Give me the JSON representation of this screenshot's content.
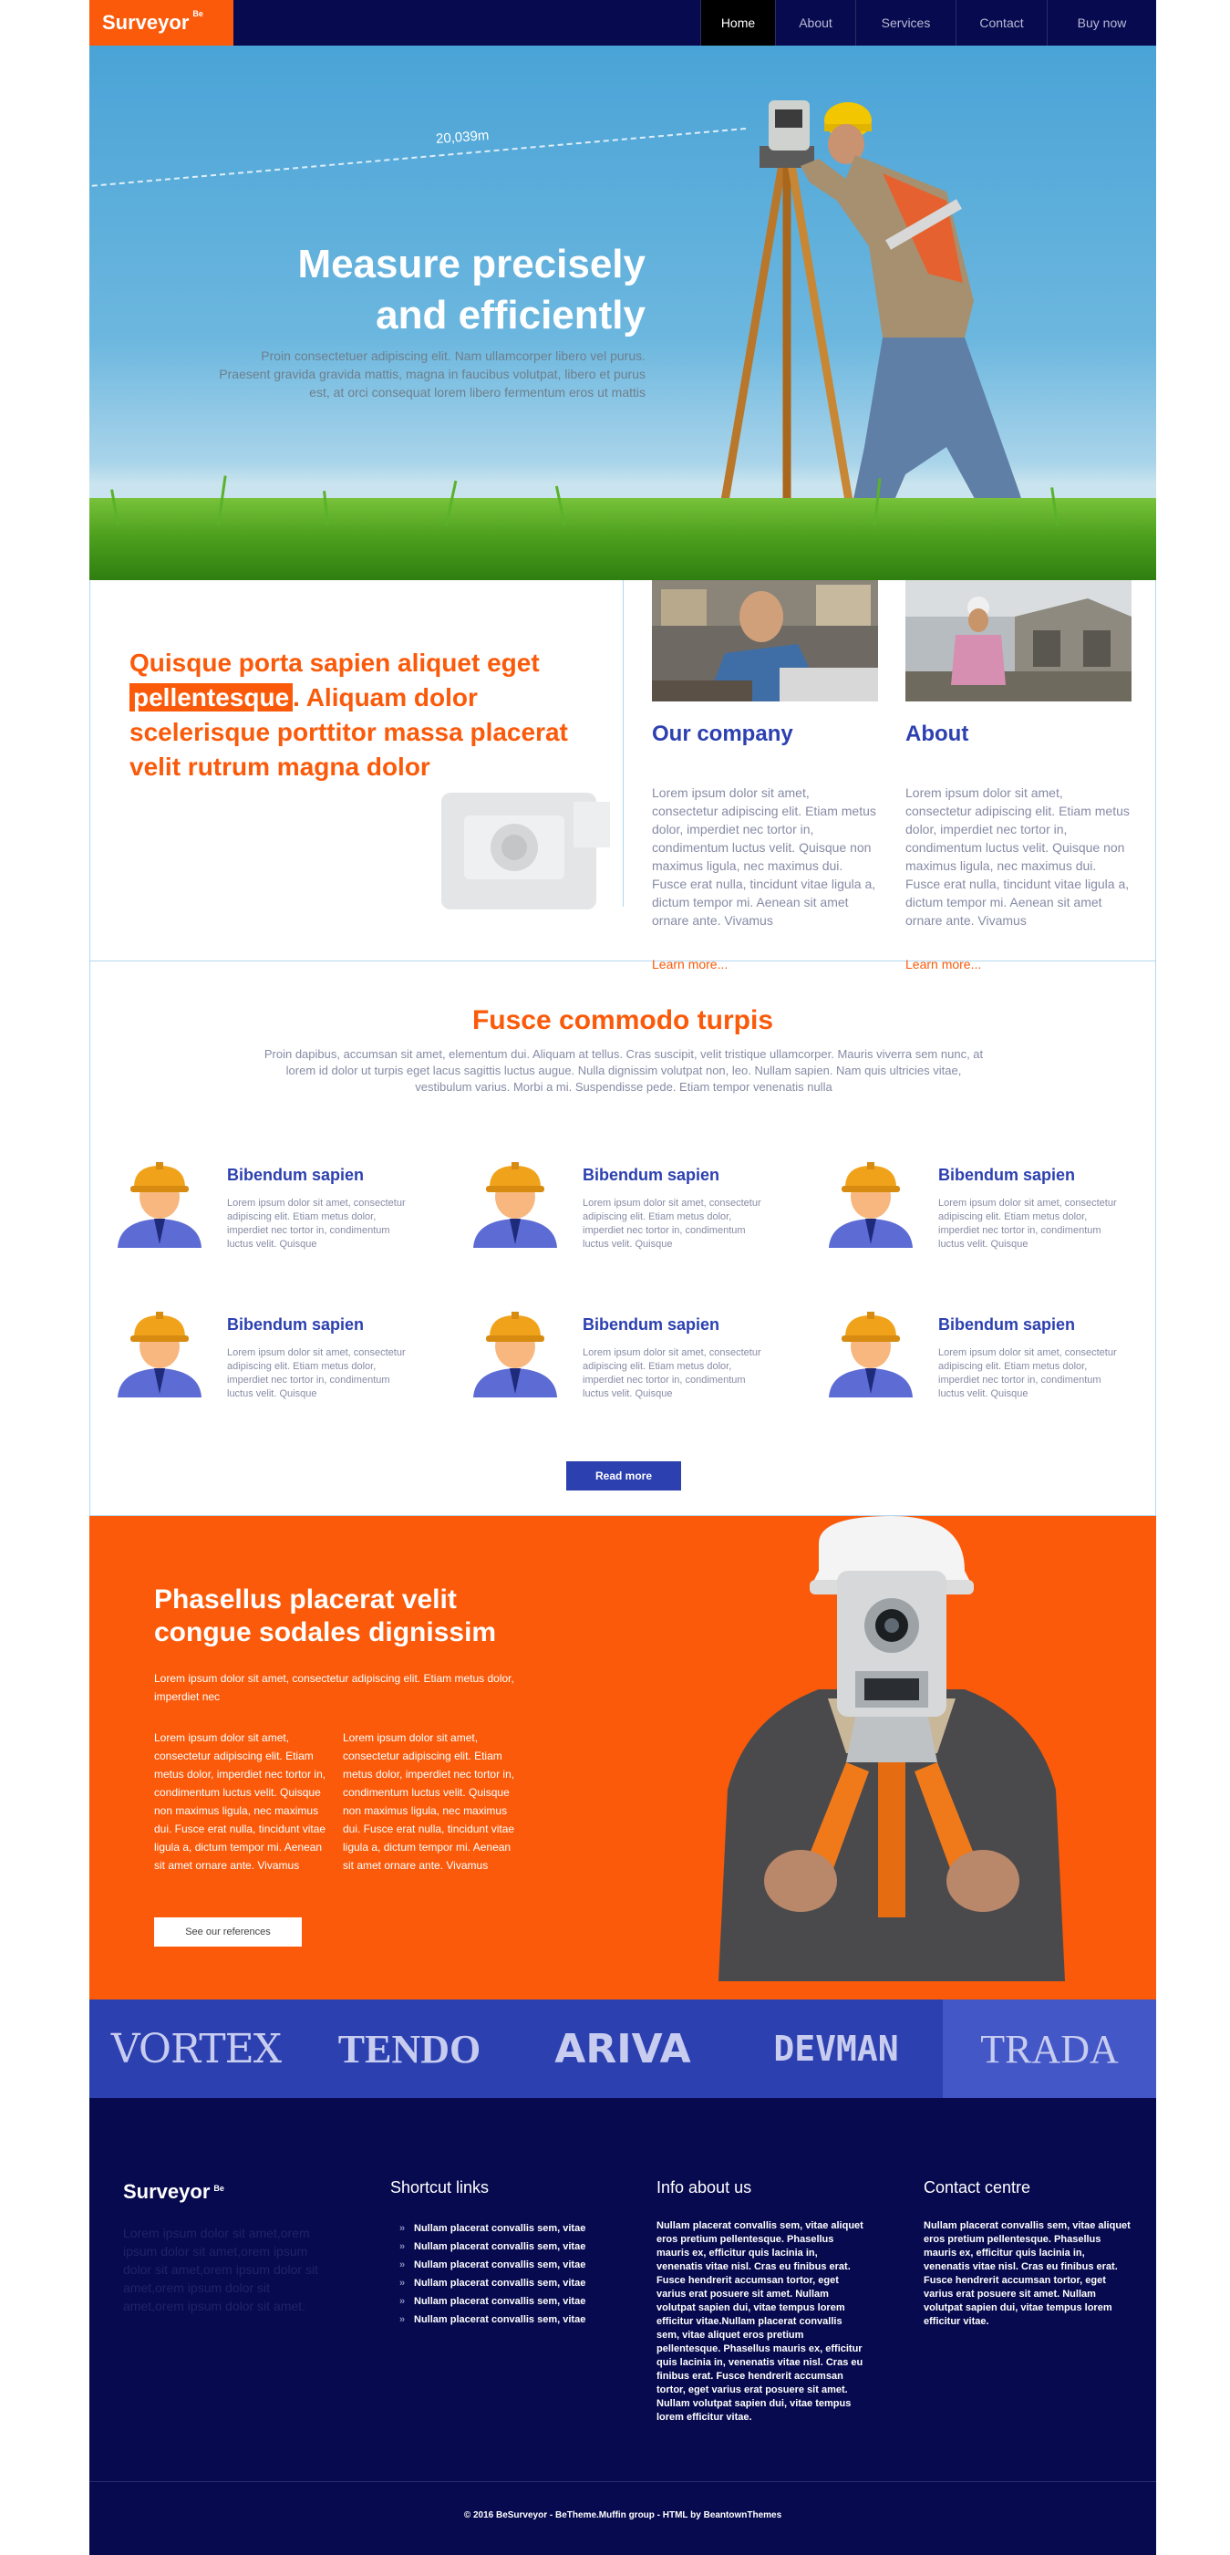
{
  "nav": {
    "logo": "Surveyor",
    "logo_sup": "Be",
    "items": [
      {
        "label": "Home",
        "active": true
      },
      {
        "label": "About",
        "active": false
      },
      {
        "label": "Services",
        "active": false
      },
      {
        "label": "Contact",
        "active": false
      },
      {
        "label": "Buy now",
        "active": false
      }
    ]
  },
  "hero": {
    "measure_label": "20,039m",
    "title_line1": "Measure precisely",
    "title_line2": "and efficiently",
    "text": "Proin consectetuer adipiscing elit. Nam ullamcorper libero vel purus. Praesent gravida gravida mattis, magna in faucibus volutpat, libero et purus est, at orci consequat lorem libero fermentum eros ut mattis"
  },
  "intro": {
    "quote_before": "Quisque porta sapien aliquet eget",
    "quote_highlight": "pellentesque",
    "quote_after": ". Aliquam dolor scelerisque porttitor massa placerat velit rutrum magna dolor",
    "cards": [
      {
        "title": "Our company",
        "text": "Lorem ipsum dolor sit amet, consectetur adipiscing elit. Etiam metus dolor, imperdiet nec tortor in, condimentum luctus velit. Quisque non maximus ligula, nec maximus dui. Fusce erat nulla, tincidunt vitae ligula a, dictum tempor mi. Aenean sit amet ornare ante. Vivamus",
        "link": "Learn more..."
      },
      {
        "title": "About",
        "text": "Lorem ipsum dolor sit amet, consectetur adipiscing elit. Etiam metus dolor, imperdiet nec tortor in, condimentum luctus velit. Quisque non maximus ligula, nec maximus dui. Fusce erat nulla, tincidunt vitae ligula a, dictum tempor mi. Aenean sit amet ornare ante. Vivamus",
        "link": "Learn more..."
      }
    ]
  },
  "services": {
    "title": "Fusce commodo turpis",
    "lead": "Proin dapibus, accumsan sit amet, elementum dui. Aliquam at tellus. Cras suscipit, velit tristique ullamcorper. Mauris viverra sem nunc, at lorem id dolor ut turpis eget lacus sagittis luctus augue. Nulla dignissim volutpat non, leo. Nullam sapien. Nam quis ultricies vitae, vestibulum varius. Morbi a mi. Suspendisse pede. Etiam tempor venenatis nulla",
    "items": [
      {
        "title": "Bibendum sapien",
        "text": "Lorem ipsum dolor sit amet, consectetur adipiscing elit. Etiam metus dolor, imperdiet nec tortor in, condimentum luctus velit. Quisque"
      },
      {
        "title": "Bibendum sapien",
        "text": "Lorem ipsum dolor sit amet, consectetur adipiscing elit. Etiam metus dolor, imperdiet nec tortor in, condimentum luctus velit. Quisque"
      },
      {
        "title": "Bibendum sapien",
        "text": "Lorem ipsum dolor sit amet, consectetur adipiscing elit. Etiam metus dolor, imperdiet nec tortor in, condimentum luctus velit. Quisque"
      },
      {
        "title": "Bibendum sapien",
        "text": "Lorem ipsum dolor sit amet, consectetur adipiscing elit. Etiam metus dolor, imperdiet nec tortor in, condimentum luctus velit. Quisque"
      },
      {
        "title": "Bibendum sapien",
        "text": "Lorem ipsum dolor sit amet, consectetur adipiscing elit. Etiam metus dolor, imperdiet nec tortor in, condimentum luctus velit. Quisque"
      },
      {
        "title": "Bibendum sapien",
        "text": "Lorem ipsum dolor sit amet, consectetur adipiscing elit. Etiam metus dolor, imperdiet nec tortor in, condimentum luctus velit. Quisque"
      }
    ],
    "read_more": "Read more"
  },
  "feature": {
    "title": "Phasellus placerat velit congue sodales dignissim",
    "lead": "Lorem ipsum dolor sit amet, consectetur adipiscing elit. Etiam metus dolor, imperdiet nec",
    "col1": "Lorem ipsum dolor sit amet, consectetur adipiscing elit. Etiam metus dolor, imperdiet nec tortor in, condimentum luctus velit. Quisque non maximus ligula, nec maximus dui. Fusce erat nulla, tincidunt vitae ligula a, dictum tempor mi. Aenean sit amet ornare ante. Vivamus",
    "col2": "Lorem ipsum dolor sit amet, consectetur adipiscing elit. Etiam metus dolor, imperdiet nec tortor in, condimentum luctus velit. Quisque non maximus ligula, nec maximus dui. Fusce erat nulla, tincidunt vitae ligula a, dictum tempor mi. Aenean sit amet ornare ante. Vivamus",
    "button": "See our references"
  },
  "logos": [
    "VORTEX",
    "TENDO",
    "ARIVA",
    "DEVMAN",
    "TRADA"
  ],
  "footer": {
    "logo": "Surveyor",
    "logo_sup": "Be",
    "about": "Lorem ipsum dolor sit amet,orem ipsum dolor sit amet,orem ipsum dolor sit amet,orem ipsum dolor sit amet,orem ipsum dolor sit amet,orem ipsum dolor sit amet.",
    "shortcut_title": "Shortcut links",
    "shortcuts": [
      "Nullam placerat convallis sem, vitae",
      "Nullam placerat convallis sem, vitae",
      "Nullam placerat convallis sem, vitae",
      "Nullam placerat convallis sem, vitae",
      "Nullam placerat convallis sem, vitae",
      "Nullam placerat convallis sem, vitae"
    ],
    "info_title": "Info about us",
    "info_text": "Nullam placerat convallis sem, vitae aliquet eros pretium pellentesque. Phasellus mauris ex, efficitur quis lacinia in, venenatis vitae nisl. Cras eu finibus erat. Fusce hendrerit accumsan tortor, eget varius erat posuere sit amet. Nullam volutpat sapien dui, vitae tempus lorem efficitur vitae.Nullam placerat convallis sem, vitae aliquet eros pretium pellentesque. Phasellus mauris ex, efficitur quis lacinia in, venenatis vitae nisl. Cras eu finibus erat. Fusce hendrerit accumsan tortor, eget varius erat posuere sit amet. Nullam volutpat sapien dui, vitae tempus lorem efficitur vitae.",
    "contact_title": "Contact centre",
    "contact_text": "Nullam placerat convallis sem, vitae aliquet eros pretium pellentesque. Phasellus mauris ex, efficitur quis lacinia in, venenatis vitae nisl. Cras eu finibus erat. Fusce hendrerit accumsan tortor, eget varius erat posuere sit amet. Nullam volutpat sapien dui, vitae tempus lorem efficitur vitae.",
    "copyright": "© 2016 BeSurveyor - BeTheme.Muffin group - HTML by BeantownThemes"
  },
  "colors": {
    "accent": "#fa5a0a",
    "brand_blue": "#2c40b0",
    "dark_navy": "#070a4e"
  }
}
